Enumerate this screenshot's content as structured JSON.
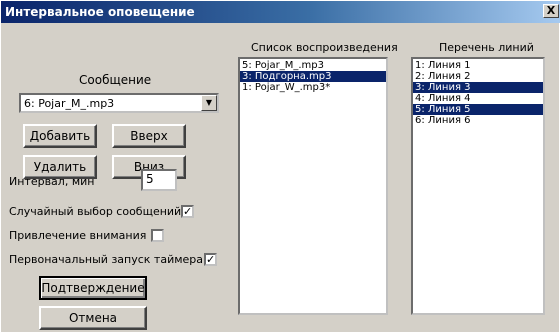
{
  "window": {
    "title": "Интервальное оповещение",
    "close_label": "X"
  },
  "message": {
    "label": "Сообщение",
    "selected": "6: Pojar_M_.mp3",
    "arrow": "▼"
  },
  "buttons": {
    "add": "Добавить",
    "up": "Вверх",
    "delete": "Удалить",
    "down": "Вниз",
    "confirm": "Подтверждение",
    "cancel": "Отмена"
  },
  "interval": {
    "label": "Интервал, мин",
    "value": "5"
  },
  "options": {
    "random": {
      "label": "Случайный выбор сообщений",
      "checked": true,
      "mark": "✓"
    },
    "attention": {
      "label": "Привлечение внимания",
      "checked": false,
      "mark": ""
    },
    "timer": {
      "label": "Первоначальный запуск таймера",
      "checked": true,
      "mark": "✓"
    }
  },
  "playlist": {
    "header": "Список воспроизведения",
    "items": [
      {
        "text": "5: Pojar_M_.mp3",
        "selected": false
      },
      {
        "text": "3: Подгорна.mp3",
        "selected": true
      },
      {
        "text": "1: Pojar_W_.mp3*",
        "selected": false
      }
    ]
  },
  "lines": {
    "header": "Перечень линий",
    "items": [
      {
        "text": "1: Линия 1",
        "selected": false
      },
      {
        "text": "2: Линия 2",
        "selected": false
      },
      {
        "text": "3: Линия 3",
        "selected": true
      },
      {
        "text": "4: Линия 4",
        "selected": false
      },
      {
        "text": "5: Линия 5",
        "selected": true
      },
      {
        "text": "6: Линия 6",
        "selected": false
      }
    ]
  },
  "colors": {
    "title_start": "#0a246a",
    "selection": "#0a246a",
    "face": "#d4d0c8"
  }
}
